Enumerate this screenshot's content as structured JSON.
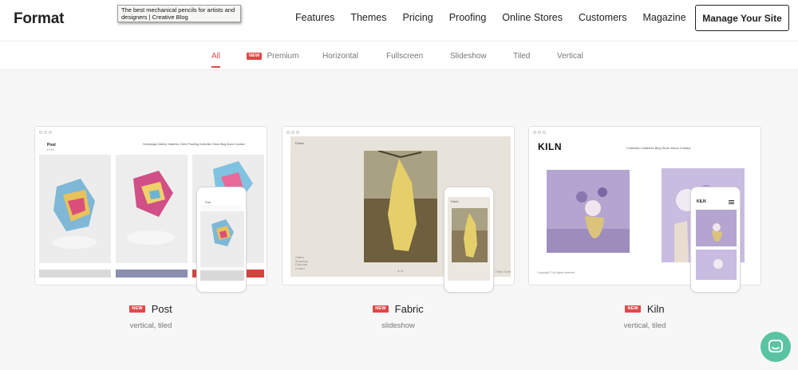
{
  "header": {
    "logo": "Format",
    "nav": [
      "Features",
      "Themes",
      "Pricing",
      "Proofing",
      "Online Stores",
      "Customers",
      "Magazine"
    ],
    "manage_label": "Manage Your Site"
  },
  "tooltip": "The best mechanical pencils for artists and designers | Creative Blog",
  "filters": {
    "all": "All",
    "premium_badge": "NEW",
    "premium": "Premium",
    "horizontal": "Horizontal",
    "fullscreen": "Fullscreen",
    "slideshow": "Slideshow",
    "tiled": "Tiled",
    "vertical": "Vertical"
  },
  "themes": [
    {
      "badge": "NEW",
      "name": "Post",
      "tags": "vertical, tiled"
    },
    {
      "badge": "NEW",
      "name": "Fabric",
      "tags": "slideshow"
    },
    {
      "badge": "NEW",
      "name": "Kiln",
      "tags": "vertical, tiled"
    }
  ],
  "previews": {
    "post": {
      "site_title": "Post",
      "nav": "Homepage Gallery  Galleries  Client Proofing  Collection  Store  Blog  About  Contact",
      "social": "▪ f ▪ t",
      "phone_title": "Post"
    },
    "fabric": {
      "site_title": "Fabric",
      "side_links": "Gallery\nSlideshow\nCollection\nContact",
      "counter": "◂ • ▸",
      "phone_title": "Fabric",
      "footer_right": "Fabric Cloth"
    },
    "kiln": {
      "logo": "KILN",
      "nav": "Collection  Galleries  Blog  Store  About  Contact",
      "footer": "Copyright © All rights reserved.",
      "phone_logo": "KILN"
    }
  },
  "colors": {
    "accent": "#e04848",
    "chat": "#5ac4a2"
  }
}
